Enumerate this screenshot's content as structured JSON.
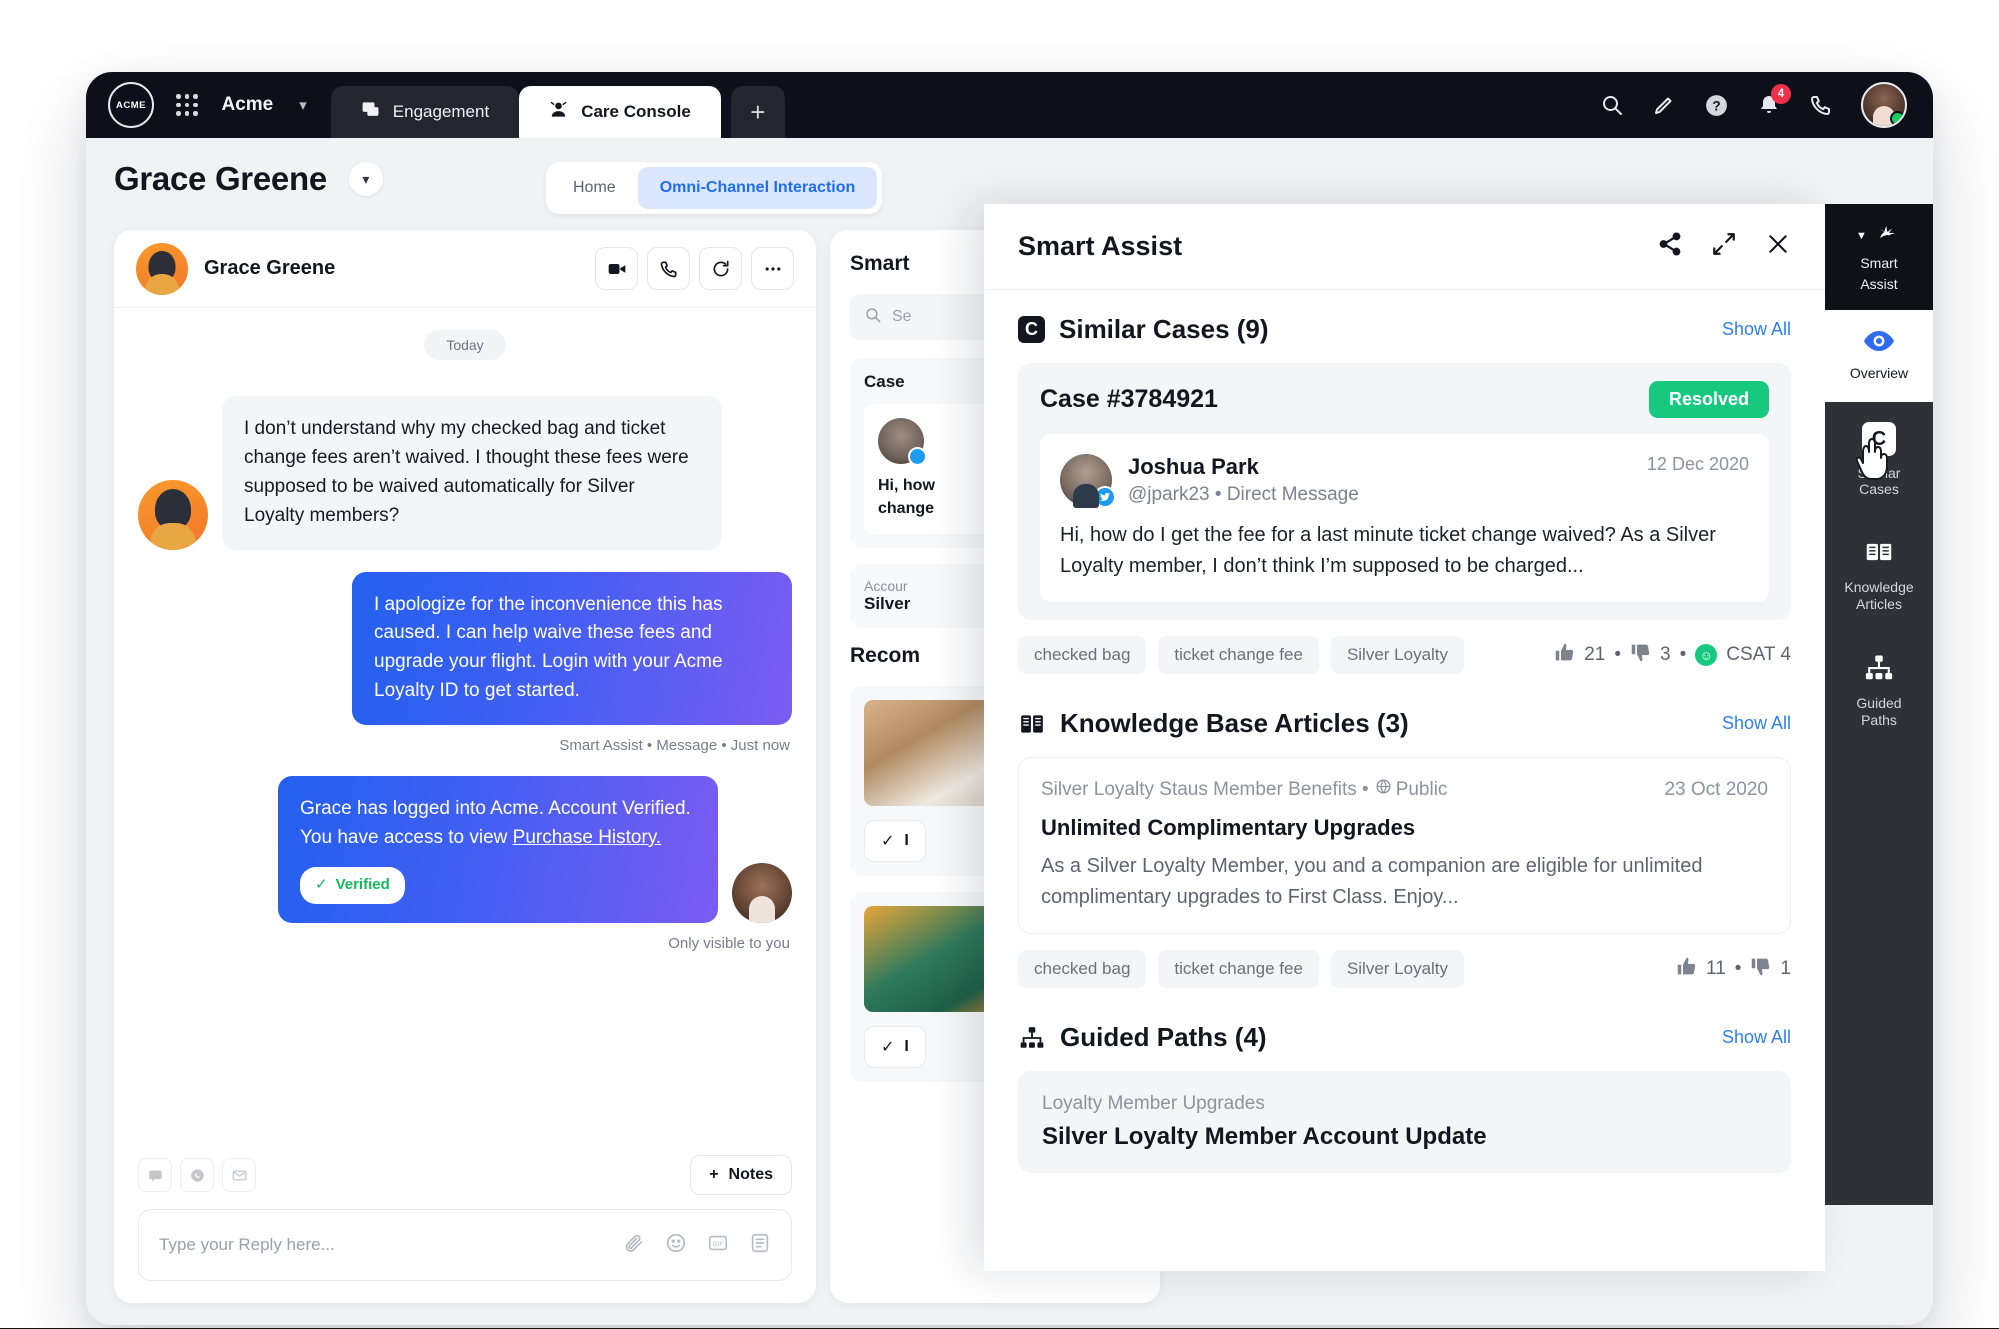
{
  "topbar": {
    "logo_text": "ACME",
    "org_name": "Acme",
    "tabs": [
      {
        "label": "Engagement",
        "icon": "chat-icon",
        "active": false
      },
      {
        "label": "Care Console",
        "icon": "agent-icon",
        "active": true
      }
    ],
    "add_tab_label": "+",
    "icons": [
      "search-icon",
      "pencil-icon",
      "help-icon",
      "bell-icon",
      "phone-icon"
    ],
    "notification_count": "4"
  },
  "header": {
    "customer_name": "Grace Greene",
    "nav": [
      {
        "label": "Home",
        "selected": false
      },
      {
        "label": "Omni-Channel Interaction",
        "selected": true
      }
    ]
  },
  "conversation": {
    "contact_name": "Grace Greene",
    "actions": [
      "video-icon",
      "phone-icon",
      "refresh-icon",
      "more-icon"
    ],
    "day_divider": "Today",
    "messages": [
      {
        "direction": "in",
        "text": "I don’t understand why my checked bag and ticket change fees aren’t waived.  I thought these fees were supposed to be waived automatically for Silver Loyalty members?"
      },
      {
        "direction": "out",
        "text": "I apologize for the inconvenience this has caused. I can help waive these fees and upgrade your flight. Login with your Acme Loyalty ID to get started.",
        "meta": "Smart Assist • Message • Just now"
      },
      {
        "direction": "out",
        "text_before_link": "Grace has logged into Acme. Account Verified. You have access to view ",
        "link_text": "Purchase History.",
        "chip": "Verified",
        "meta": "Only visible to you"
      }
    ],
    "composer": {
      "mini_buttons": [
        "sms-icon",
        "whatsapp-icon",
        "email-icon"
      ],
      "notes_label": "Notes",
      "placeholder": "Type your Reply here...",
      "icons": [
        "attach-icon",
        "emoji-icon",
        "gif-icon",
        "template-icon"
      ]
    }
  },
  "mid_panel": {
    "title": "Smart",
    "search_placeholder": "Se",
    "case_card_title": "Case ",
    "case_text_line1": "Hi, how",
    "case_text_line2": "change",
    "account_label": "Accour",
    "account_value": "Silver ",
    "recommendations_title": "Recom",
    "insert_label": "I"
  },
  "rail": {
    "header": {
      "label_line1": "Smart",
      "label_line2": "Assist",
      "icon": "sparkle-icon"
    },
    "items": [
      {
        "label_line1": "Overview",
        "label_line2": "",
        "icon": "eye-icon",
        "selected": true
      },
      {
        "label_line1": "Similar",
        "label_line2": "Cases",
        "icon": "case-icon",
        "selected": false
      },
      {
        "label_line1": "Knowledge",
        "label_line2": "Articles",
        "icon": "book-icon",
        "selected": false
      },
      {
        "label_line1": "Guided",
        "label_line2": "Paths",
        "icon": "hierarchy-icon",
        "selected": false
      }
    ]
  },
  "smart_assist": {
    "title": "Smart Assist",
    "header_icons": [
      "share-icon",
      "expand-icon",
      "close-icon"
    ],
    "similar_cases": {
      "heading": "Similar Cases (9)",
      "show_all": "Show All",
      "case_number": "Case #3784921",
      "status": "Resolved",
      "author_name": "Joshua Park",
      "author_handle": "@jpark23 • Direct Message",
      "date": "12 Dec 2020",
      "body": "Hi, how do I get the fee for a last minute ticket change waived? As a Silver Loyalty member, I don’t think I’m supposed to be charged...",
      "tags": [
        "checked bag",
        "ticket change fee",
        "Silver Loyalty"
      ],
      "upvotes": "21",
      "downvotes": "3",
      "csat": "CSAT 4"
    },
    "knowledge_base": {
      "heading": "Knowledge Base Articles (3)",
      "show_all": "Show All",
      "source": "Silver Loyalty Staus Member Benefits •",
      "visibility": "Public",
      "date": "23 Oct 2020",
      "title": "Unlimited Complimentary Upgrades",
      "body": "As a Silver Loyalty Member, you and a companion are eligible for unlimited complimentary upgrades to First Class. Enjoy...",
      "tags": [
        "checked bag",
        "ticket change fee",
        "Silver Loyalty"
      ],
      "upvotes": "11",
      "downvotes": "1"
    },
    "guided_paths": {
      "heading": "Guided Paths (4)",
      "show_all": "Show All",
      "category": "Loyalty Member Upgrades",
      "title": "Silver Loyalty Member Account Update"
    }
  },
  "colors": {
    "accent_blue": "#2f80ed",
    "resolved_green": "#16c97e",
    "topbar_dark": "#0d0f1a",
    "rail_gray": "#2f3137",
    "bubble_gradient_start": "#2460ee",
    "bubble_gradient_end": "#7b5cf2"
  }
}
